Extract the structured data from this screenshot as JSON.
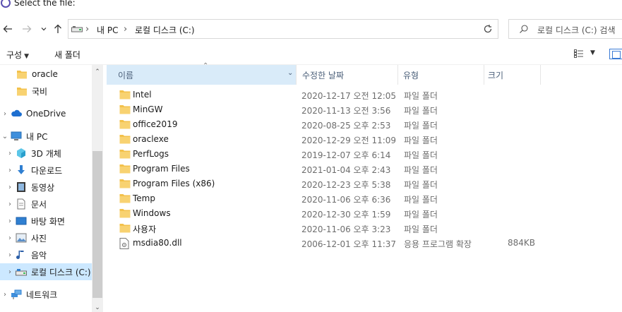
{
  "window": {
    "title": "Select the file:"
  },
  "nav": {
    "back_icon": "back-arrow-icon",
    "forward_icon": "forward-arrow-icon",
    "recent_icon": "chevron-down-icon",
    "up_icon": "up-arrow-icon"
  },
  "address": {
    "crumbs": [
      "내 PC",
      "로컬 디스크 (C:)"
    ],
    "search_placeholder": "로컬 디스크 (C:) 검색"
  },
  "commands": {
    "organize": "구성",
    "new_folder": "새 폴더"
  },
  "navpane": {
    "items": [
      {
        "label": "oracle",
        "icon": "folder-icon"
      },
      {
        "label": "국비",
        "icon": "folder-icon"
      },
      {
        "label": "OneDrive",
        "icon": "cloud-icon"
      },
      {
        "label": "내 PC",
        "icon": "computer-icon"
      },
      {
        "label": "3D 개체",
        "icon": "cube-icon"
      },
      {
        "label": "다운로드",
        "icon": "download-icon"
      },
      {
        "label": "동영상",
        "icon": "video-icon"
      },
      {
        "label": "문서",
        "icon": "document-icon"
      },
      {
        "label": "바탕 화면",
        "icon": "desktop-icon"
      },
      {
        "label": "사진",
        "icon": "picture-icon"
      },
      {
        "label": "음악",
        "icon": "music-icon"
      },
      {
        "label": "로컬 디스크 (C:)",
        "icon": "drive-icon"
      },
      {
        "label": "네트워크",
        "icon": "network-icon"
      }
    ]
  },
  "columns": {
    "name": "이름",
    "date": "수정한 날짜",
    "type": "유형",
    "size": "크기"
  },
  "files": [
    {
      "name": "Intel",
      "date": "2020-12-17 오전 12:05",
      "type": "파일 폴더",
      "size": "",
      "icon": "folder-icon"
    },
    {
      "name": "MinGW",
      "date": "2020-11-13 오전 3:56",
      "type": "파일 폴더",
      "size": "",
      "icon": "folder-icon"
    },
    {
      "name": "office2019",
      "date": "2020-08-25 오후 2:53",
      "type": "파일 폴더",
      "size": "",
      "icon": "folder-icon"
    },
    {
      "name": "oraclexe",
      "date": "2020-12-29 오전 11:09",
      "type": "파일 폴더",
      "size": "",
      "icon": "folder-icon"
    },
    {
      "name": "PerfLogs",
      "date": "2019-12-07 오후 6:14",
      "type": "파일 폴더",
      "size": "",
      "icon": "folder-icon"
    },
    {
      "name": "Program Files",
      "date": "2021-01-04 오후 2:43",
      "type": "파일 폴더",
      "size": "",
      "icon": "folder-icon"
    },
    {
      "name": "Program Files (x86)",
      "date": "2020-12-23 오후 5:38",
      "type": "파일 폴더",
      "size": "",
      "icon": "folder-icon"
    },
    {
      "name": "Temp",
      "date": "2020-11-06 오후 6:36",
      "type": "파일 폴더",
      "size": "",
      "icon": "folder-icon"
    },
    {
      "name": "Windows",
      "date": "2020-12-30 오후 1:59",
      "type": "파일 폴더",
      "size": "",
      "icon": "folder-icon"
    },
    {
      "name": "사용자",
      "date": "2020-11-06 오후 3:23",
      "type": "파일 폴더",
      "size": "",
      "icon": "folder-icon"
    },
    {
      "name": "msdia80.dll",
      "date": "2006-12-01 오후 11:37",
      "type": "응용 프로그램 확장",
      "size": "884KB",
      "icon": "dll-file-icon"
    }
  ],
  "colors": {
    "selection": "#cce8ff",
    "sorted_header": "#d9ebf9",
    "folder": "#f3c14b",
    "accent": "#3a7bd5"
  }
}
